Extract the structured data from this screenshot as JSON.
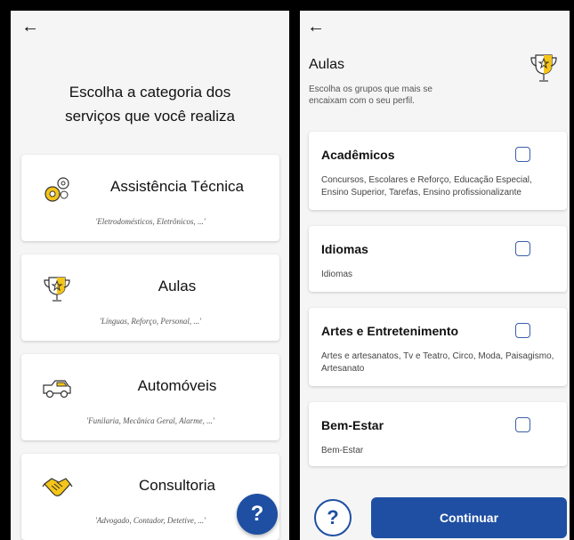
{
  "left": {
    "back_icon": "arrow-left-icon",
    "title": "Escolha a categoria dos serviços que você realiza",
    "categories": [
      {
        "name": "Assistência Técnica",
        "desc": "'Eletrodomésticos, Eletrônicos, ...'",
        "icon": "gears-icon"
      },
      {
        "name": "Aulas",
        "desc": "'Línguas, Reforço, Personal, ...'",
        "icon": "trophy-icon"
      },
      {
        "name": "Automóveis",
        "desc": "'Funilaria, Mecânica Geral, Alarme, ...'",
        "icon": "car-icon"
      },
      {
        "name": "Consultoria",
        "desc": "'Advogado, Contador, Detetive, ...'",
        "icon": "handshake-icon"
      }
    ],
    "help_label": "?"
  },
  "right": {
    "back_icon": "arrow-left-icon",
    "title": "Aulas",
    "subtitle": "Escolha os grupos que mais se encaixam com o seu perfil.",
    "groups": [
      {
        "name": "Acadêmicos",
        "desc": "Concursos, Escolares e Reforço, Educação Especial, Ensino Superior, Tarefas, Ensino profissionalizante",
        "checked": false
      },
      {
        "name": "Idiomas",
        "desc": "Idiomas",
        "checked": false
      },
      {
        "name": "Artes e Entretenimento",
        "desc": "Artes e artesanatos, Tv e Teatro, Circo, Moda, Paisagismo, Artesanato",
        "checked": false
      },
      {
        "name": "Bem-Estar",
        "desc": "Bem-Estar",
        "checked": false
      }
    ],
    "help_label": "?",
    "continue_label": "Continuar"
  },
  "colors": {
    "primary": "#1e4fa3",
    "accent": "#f5c518",
    "background": "#f5f5f5"
  }
}
